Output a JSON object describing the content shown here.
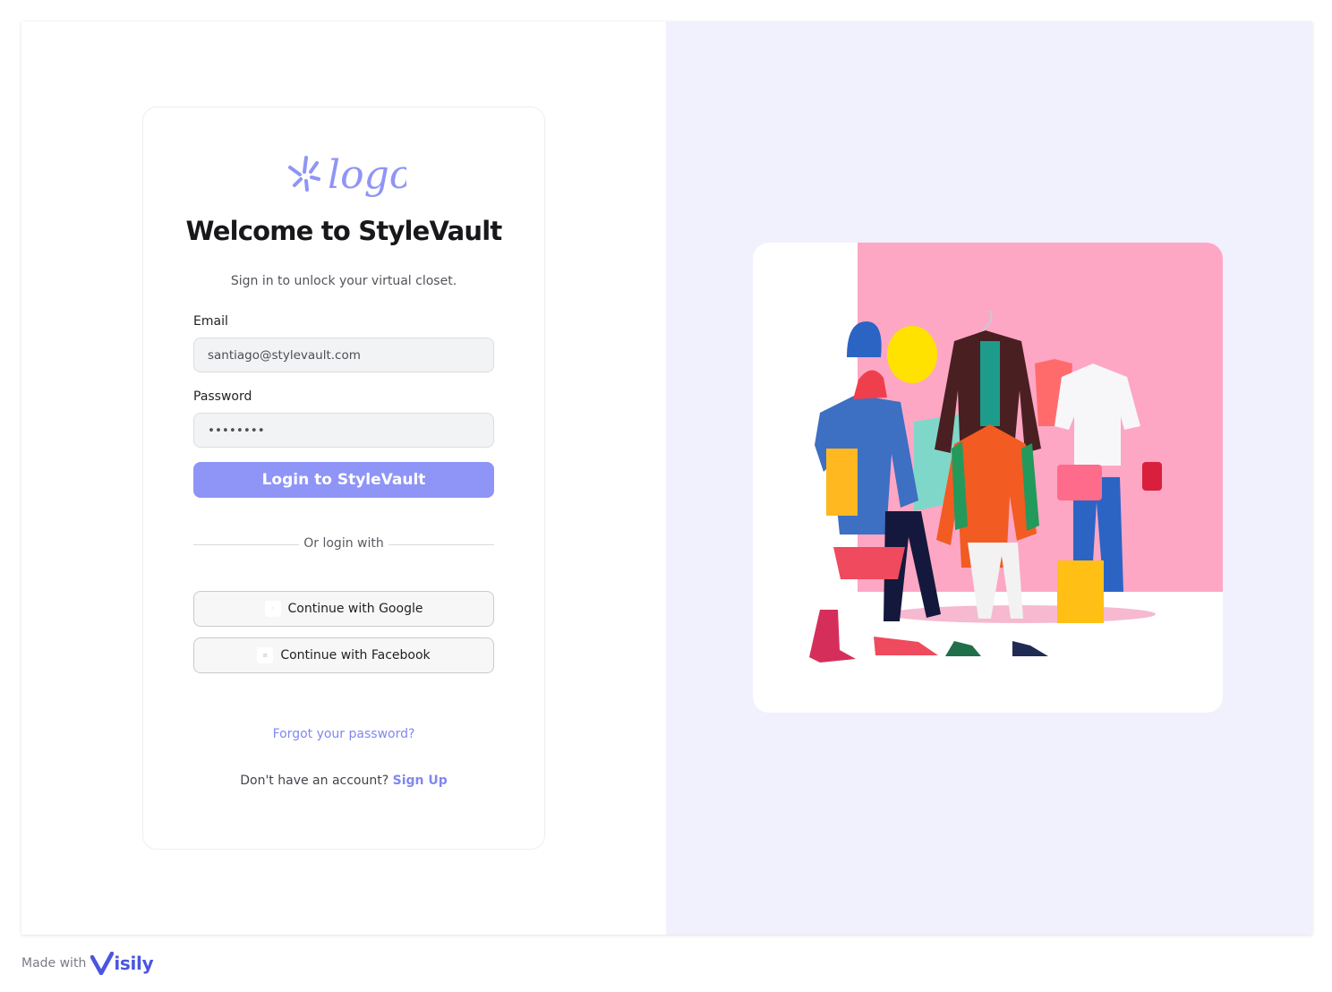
{
  "brand": {
    "logo_text": "logo",
    "accent_color": "#8f95f6",
    "link_color": "#8087f2"
  },
  "login": {
    "title": "Welcome to StyleVault",
    "subtitle": "Sign in to unlock your virtual closet.",
    "email_label": "Email",
    "email_value": "santiago@stylevault.com",
    "password_label": "Password",
    "password_value": "••••••••",
    "submit_label": "Login to StyleVault",
    "divider_text": "Or login with",
    "google_label": "Continue with Google",
    "google_icon": "google-icon",
    "facebook_label": "Continue with Facebook",
    "facebook_icon": "facebook-icon",
    "forgot_label": "Forgot your password?",
    "no_account_text": "Don't have an account?",
    "signup_label": "Sign Up"
  },
  "illustration": {
    "subject": "clothes-rack-illustration",
    "background_color": "#fda7c4"
  },
  "footer": {
    "made_with": "Made with",
    "brand": "isily"
  }
}
